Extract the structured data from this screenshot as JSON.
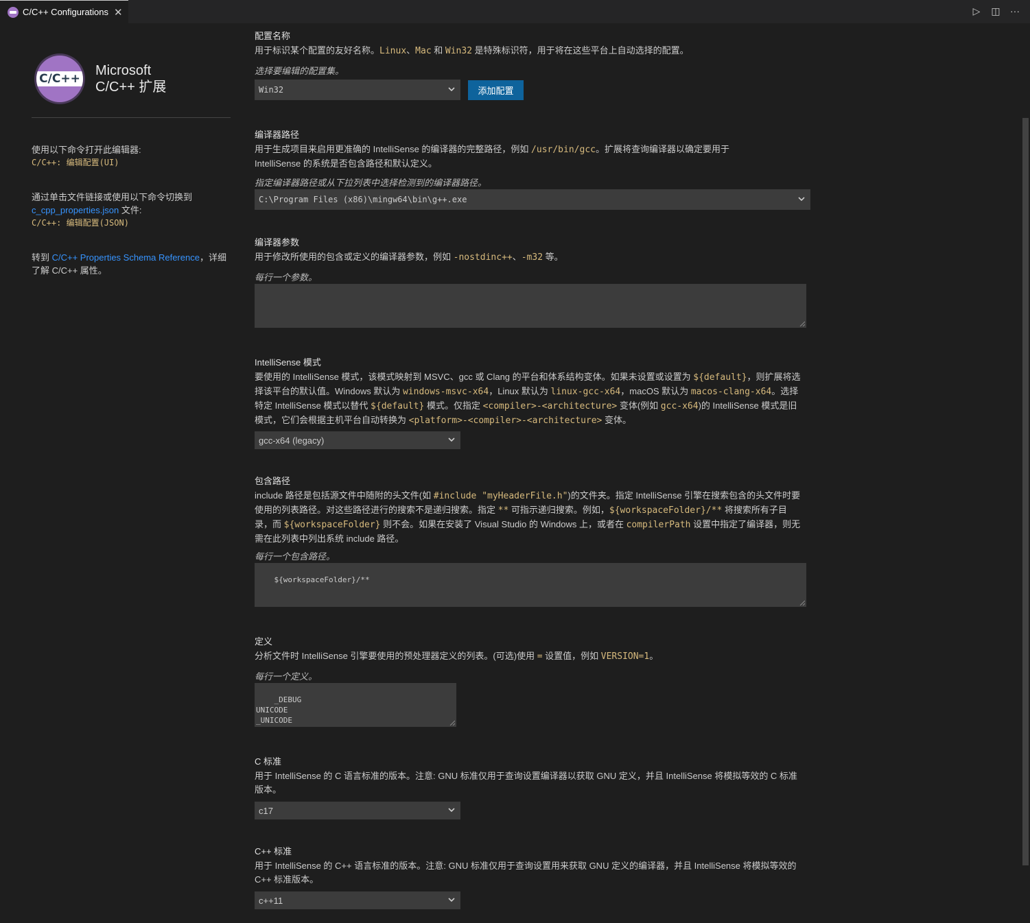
{
  "tab": {
    "title": "C/C++ Configurations",
    "close": "✕"
  },
  "tab_actions": {
    "run": "▷",
    "split": "◫",
    "more": "···"
  },
  "brand": {
    "logo_text": "C/C++",
    "line1": "Microsoft",
    "line2": "C/C++ 扩展"
  },
  "left": {
    "open_cmd_text": "使用以下命令打开此编辑器:",
    "open_cmd": "C/C++: 编辑配置(UI)",
    "switch_text": "通过单击文件链接或使用以下命令切换到",
    "switch_link": "c_cpp_properties.json",
    "switch_suffix": " 文件:",
    "switch_cmd": "C/C++: 编辑配置(JSON)",
    "ref_prefix": "转到 ",
    "ref_link": "C/C++ Properties Schema Reference",
    "ref_suffix": "，详细了解 C/C++ 属性。"
  },
  "config_name": {
    "title": "配置名称",
    "desc_1": "用于标识某个配置的友好名称。",
    "code_linux": "Linux",
    "sep_1": "、",
    "code_mac": "Mac",
    "and": " 和 ",
    "code_win": "Win32",
    "desc_2": " 是特殊标识符，用于将在这些平台上自动选择的配置。",
    "hint": "选择要编辑的配置集。",
    "select_value": "Win32",
    "add_button": "添加配置"
  },
  "compiler_path": {
    "title": "编译器路径",
    "desc_1": "用于生成项目来启用更准确的 IntelliSense 的编译器的完整路径，例如 ",
    "code_1": "/usr/bin/gcc",
    "desc_2": "。扩展将查询编译器以确定要用于 IntelliSense 的系统是否包含路径和默认定义。",
    "hint": "指定编译器路径或从下拉列表中选择检测到的编译器路径。",
    "value": "C:\\Program Files (x86)\\mingw64\\bin\\g++.exe"
  },
  "compiler_args": {
    "title": "编译器参数",
    "desc_1": "用于修改所使用的包含或定义的编译器参数，例如 ",
    "code_1": "-nostdinc++",
    "sep": "、",
    "code_2": "-m32",
    "desc_2": " 等。",
    "hint": "每行一个参数。",
    "value": ""
  },
  "intellisense": {
    "title": "IntelliSense 模式",
    "d1": "要使用的 IntelliSense 模式，该模式映射到 MSVC、gcc 或 Clang 的平台和体系结构变体。如果未设置或设置为 ",
    "c1": "${default}",
    "d2": "，则扩展将选择该平台的默认值。Windows 默认为 ",
    "c2": "windows-msvc-x64",
    "d3": "，Linux 默认为 ",
    "c3": "linux-gcc-x64",
    "d4": "，macOS 默认为 ",
    "c4": "macos-clang-x64",
    "d5": "。选择特定 IntelliSense 模式以替代 ",
    "c5": "${default}",
    "d6": " 模式。仅指定 ",
    "c6": "<compiler>-<architecture>",
    "d7": " 变体(例如 ",
    "c7": "gcc-x64",
    "d8": ")的 IntelliSense 模式是旧模式，它们会根据主机平台自动转换为 ",
    "c8": "<platform>-<compiler>-<architecture>",
    "d9": " 变体。",
    "select_value": "gcc-x64 (legacy)"
  },
  "include_path": {
    "title": "包含路径",
    "d1": "include 路径是包括源文件中随附的头文件(如 ",
    "c1": "#include \"myHeaderFile.h\"",
    "d2": ")的文件夹。指定 IntelliSense 引擎在搜索包含的头文件时要使用的列表路径。对这些路径进行的搜索不是递归搜索。指定 ",
    "c2": "**",
    "d3": " 可指示递归搜索。例如，",
    "c3": "${workspaceFolder}/**",
    "d4": " 将搜索所有子目录，而 ",
    "c4": "${workspaceFolder}",
    "d5": " 则不会。如果在安装了 Visual Studio 的 Windows 上，或者在 ",
    "c5": "compilerPath",
    "d6": " 设置中指定了编译器，则无需在此列表中列出系统 include 路径。",
    "hint": "每行一个包含路径。",
    "value": "${workspaceFolder}/**"
  },
  "defines": {
    "title": "定义",
    "d1": "分析文件时 IntelliSense 引擎要使用的预处理器定义的列表。(可选)使用 ",
    "c1": "=",
    "d2": " 设置值，例如 ",
    "c2": "VERSION=1",
    "d3": "。",
    "hint": "每行一个定义。",
    "value": "_DEBUG\nUNICODE\n_UNICODE"
  },
  "c_standard": {
    "title": "C 标准",
    "desc": "用于 IntelliSense 的 C 语言标准的版本。注意: GNU 标准仅用于查询设置编译器以获取 GNU 定义，并且 IntelliSense 将模拟等效的 C 标准版本。",
    "select_value": "c17"
  },
  "cpp_standard": {
    "title": "C++ 标准",
    "desc": "用于 IntelliSense 的 C++ 语言标准的版本。注意: GNU 标准仅用于查询设置用来获取 GNU 定义的编译器，并且 IntelliSense 将模拟等效的 C++ 标准版本。",
    "select_value": "c++11"
  },
  "colors": {
    "background": "#1e1e1e",
    "code": "#d7ba7d",
    "link": "#3794ff",
    "button": "#0e639c",
    "input": "#3c3c3c",
    "logo_purple": "#a074c4"
  }
}
